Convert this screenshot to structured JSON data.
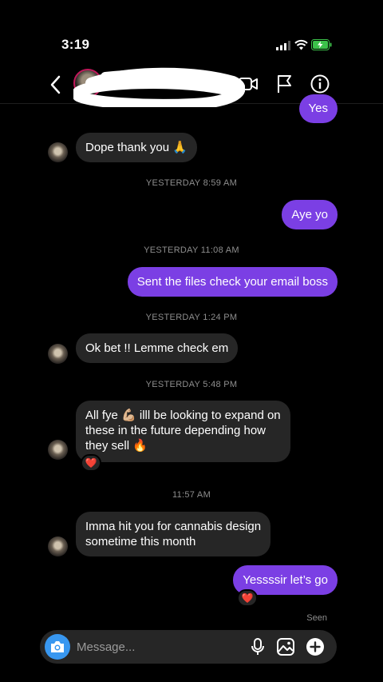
{
  "status_bar": {
    "time": "3:19"
  },
  "header": {
    "icons": [
      "back-icon",
      "video-call-icon",
      "flag-icon",
      "info-icon"
    ]
  },
  "messages": [
    {
      "type": "outgoing",
      "text": "Yes"
    },
    {
      "type": "incoming",
      "text": "Dope thank you 🙏"
    },
    {
      "type": "timestamp",
      "text": "YESTERDAY 8:59 AM"
    },
    {
      "type": "outgoing",
      "text": "Aye yo"
    },
    {
      "type": "timestamp",
      "text": "YESTERDAY 11:08 AM"
    },
    {
      "type": "outgoing",
      "text": "Sent the files check your email boss"
    },
    {
      "type": "timestamp",
      "text": "YESTERDAY 1:24 PM"
    },
    {
      "type": "incoming",
      "text": "Ok bet !! Lemme check em"
    },
    {
      "type": "timestamp",
      "text": "YESTERDAY 5:48 PM"
    },
    {
      "type": "incoming",
      "text": "All fye 💪🏼 illl be looking to expand on\nthese in the future depending how\nthey sell 🔥",
      "reaction": "❤️"
    },
    {
      "type": "timestamp",
      "text": "11:57 AM"
    },
    {
      "type": "incoming",
      "text": "Imma hit you for cannabis design\nsometime this month"
    },
    {
      "type": "outgoing",
      "text": "Yessssir let’s go",
      "reaction": "❤️"
    }
  ],
  "seen_label": "Seen",
  "composer": {
    "placeholder": "Message...",
    "icons": [
      "camera-icon",
      "microphone-icon",
      "gallery-icon",
      "add-icon"
    ],
    "accent": "#3897f0"
  },
  "colors": {
    "outgoing_bubble": "#7b3fe4",
    "incoming_bubble": "#262626",
    "background": "#000000"
  }
}
